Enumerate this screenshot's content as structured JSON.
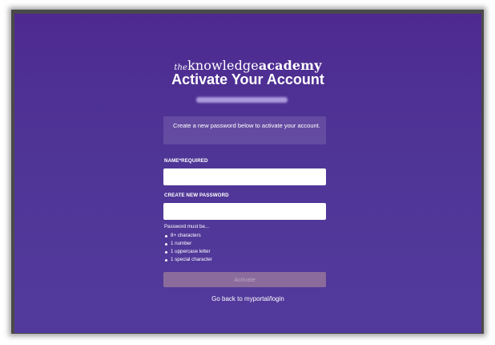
{
  "brand": {
    "logo_prefix": "the",
    "logo_knowledge": "knowledge",
    "logo_academy": "academy"
  },
  "header": {
    "title": "Activate Your Account"
  },
  "info": {
    "message": "Create a new password below to activate your account."
  },
  "form": {
    "name_label": "NAME*REQUIRED",
    "name_value": "",
    "password_label": "CREATE NEW PASSWORD",
    "password_value": ""
  },
  "requirements": {
    "title": "Password must be...",
    "items": [
      "8+ characters",
      "1 number",
      "1 uppercase letter",
      "1 special character"
    ]
  },
  "actions": {
    "activate_label": "Activate",
    "back_link_label": "Go back to myportal/login"
  },
  "colors": {
    "background": "#4f3596",
    "button_disabled": "#8b6b9b",
    "text": "#ffffff"
  }
}
